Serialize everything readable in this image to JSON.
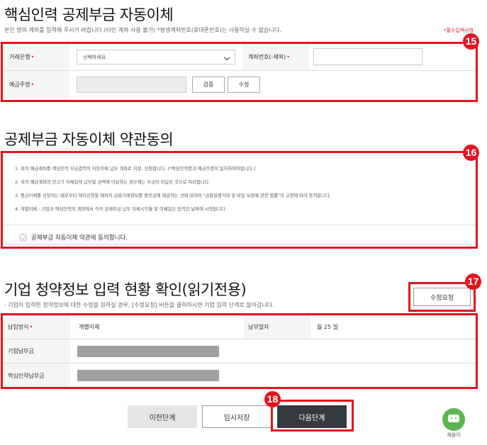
{
  "section1": {
    "title": "핵심인력 공제부금 자동이체",
    "description": "본인 명의 계좌를 입력해 주시기 바랍니다.(타인 계좌 사용 불가) *평생계좌번호(휴대폰번호)는 사용하실 수 없습니다.",
    "required_note": "필수입력사항",
    "marker": "15",
    "bank_label": "거래은행",
    "bank_select": "선택하세요",
    "account_label": "계좌번호(-제외)",
    "holder_label": "예금주명",
    "verify_button": "검증",
    "edit_button": "수정"
  },
  "section2": {
    "title": "공제부금 자동이체 약관동의",
    "marker": "16",
    "terms": [
      "1. 위의 예금계좌를 핵심인력 부금결력의 자동이체 납부 계좌로 지정, 신청합니다. (*핵심인력명과 예금주명이 일치하여야합니다.)",
      "2. 위의 예금계좌의 잔고가 이체일에 납부할 금액에 미달하는 경우에는 부금이 미납된 것으로 처리됩니다.",
      "3. 중금이체를 신청하는 때로부터 해지신청할 때까지 금융거래정보를 중진공에 제공하는 것에 대하여 \"금융실명거래 및 비밀 보장에 관한 법률\"의 규정에 따라 동의합니다.",
      "4. 개별이체 : 기업과 핵심인력의 계좌에서 각각 공제부금 납부 이체시작월 및 이체일은 입력한 날짜에 시작됩니다."
    ],
    "agree_label": "공제부금 자동이체 약관에 동의합니다."
  },
  "section3": {
    "title": "기업 청약정보 입력 현황 확인(읽기전용)",
    "description": "· 기업이 입력한 청약정보에 대한 수정을 원하실 경우, [수정요청] 버튼을 클릭하시면 기업 입력 단계로 돌아갑니다.",
    "edit_request_button": "수정요청",
    "marker_edit": "17",
    "rows": {
      "payment_method_label": "납입방식",
      "payment_method_value": "개별이체",
      "payment_date_label": "납부일자",
      "payment_date_value": "월 25 일",
      "company_payment_label": "기업납부금",
      "employee_payment_label": "핵심인력납부금"
    }
  },
  "footer": {
    "prev_button": "이전단계",
    "save_button": "임시저장",
    "next_button": "다음단계",
    "marker": "18",
    "chatbot_label": "채움이"
  },
  "colors": {
    "highlight": "#e3141d",
    "primary_dark": "#333a40",
    "chatbot": "#5bb550"
  }
}
